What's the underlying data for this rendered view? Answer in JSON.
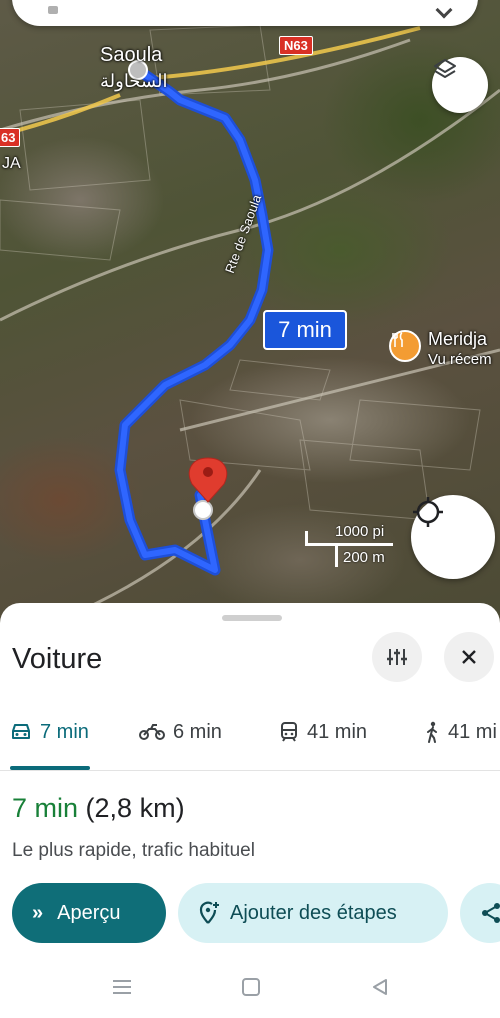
{
  "map": {
    "place_label": "Saoula",
    "place_label_ar": "السحاولة",
    "area_label": "JA",
    "street_label": "Rte de Saoula",
    "road_shield_1": "N63",
    "road_shield_2": "63",
    "route_time_chip": "7 min",
    "poi_name": "Meridja",
    "poi_subtitle": "Vu récem",
    "scale_imperial": "1000 pi",
    "scale_metric": "200 m",
    "colors": {
      "route": "#1a56db",
      "destination_pin": "#e03c2e",
      "poi": "#f39c33"
    }
  },
  "sheet": {
    "title": "Voiture",
    "modes": [
      {
        "icon": "car-icon",
        "label": "7 min",
        "active": true
      },
      {
        "icon": "motorcycle-icon",
        "label": "6 min",
        "active": false
      },
      {
        "icon": "transit-icon",
        "label": "41 min",
        "active": false
      },
      {
        "icon": "walk-icon",
        "label": "41 mi",
        "active": false
      }
    ],
    "route": {
      "time": "7 min",
      "distance": "(2,8 km)",
      "description": "Le plus rapide, trafic habituel"
    },
    "actions": {
      "apercu": "Aperçu",
      "apercu_arrow": "»",
      "add_stops": "Ajouter des étapes"
    },
    "accent_color": "#0b6b7a",
    "time_color": "#188038"
  }
}
